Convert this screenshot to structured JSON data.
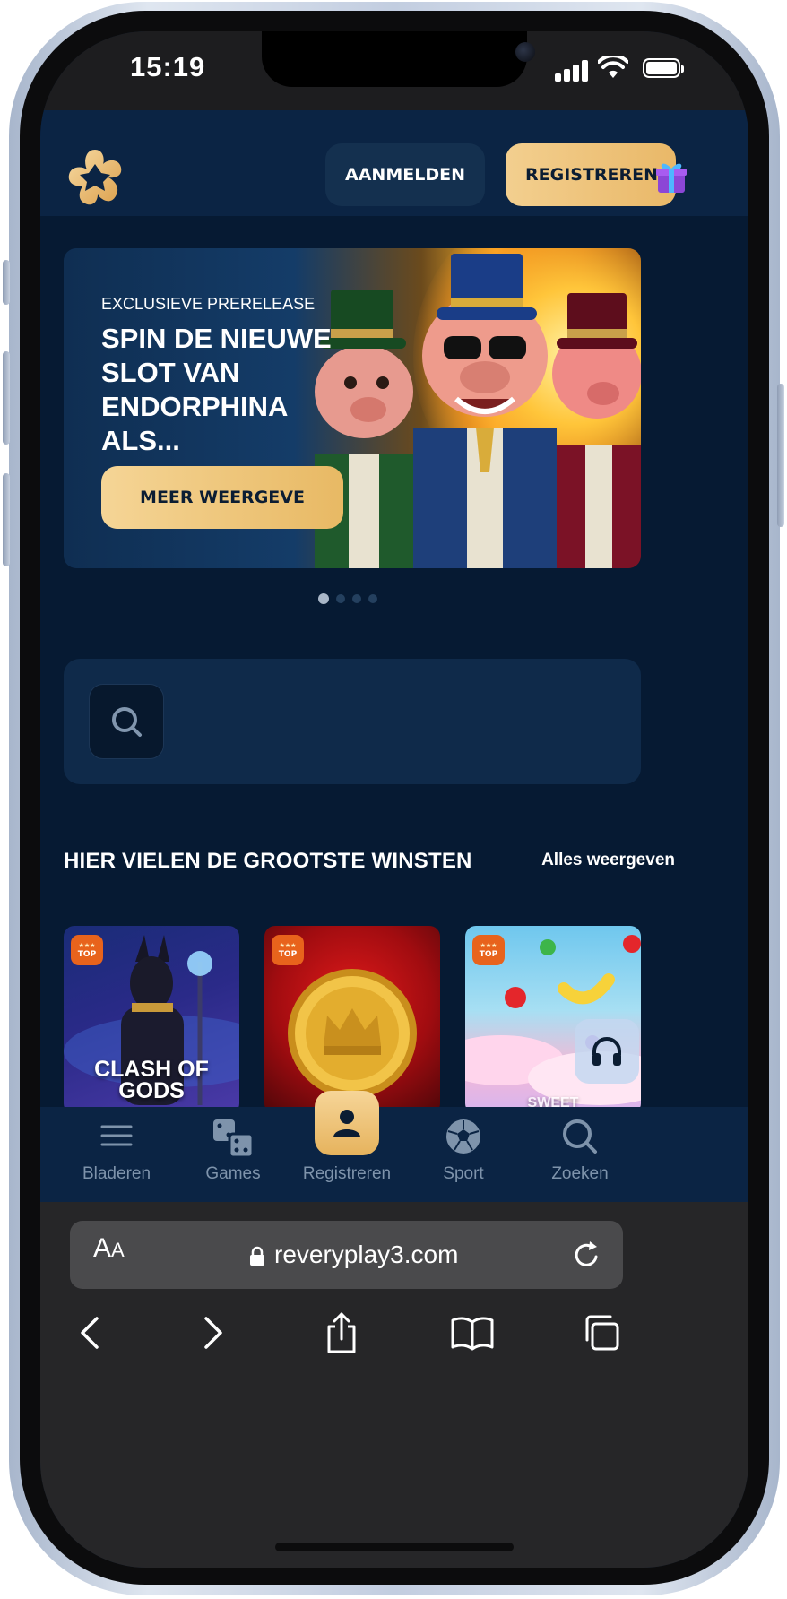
{
  "status_bar": {
    "time": "15:19"
  },
  "header": {
    "logo_icon": "brand-logo-icon",
    "login_label": "AANMELDEN",
    "register_label": "REGISTREREN",
    "gift_icon": "gift-icon",
    "accent_color": "#f0c67e"
  },
  "banner": {
    "eyebrow": "EXCLUSIEVE PRERELEASE",
    "title": "SPIN DE NIEUWE SLOT VAN ENDORPHINA ALS...",
    "button_label": "MEER WEERGEVE",
    "slide_count": 4,
    "active_slide": 1
  },
  "search": {
    "icon": "search-icon"
  },
  "section": {
    "title": "HIER VIELEN DE GROOTSTE WINSTEN",
    "link": "Alles weergeven"
  },
  "games": [
    {
      "caption": "CLASH OF GODS",
      "badge": "TOP",
      "badge_stars": "★★★"
    },
    {
      "caption": "",
      "badge": "TOP",
      "badge_stars": "★★★"
    },
    {
      "caption": "SWEET",
      "badge": "TOP",
      "badge_stars": "★★★"
    }
  ],
  "bottom_nav": [
    {
      "label": "Bladeren",
      "icon": "menu-icon"
    },
    {
      "label": "Games",
      "icon": "dice-icon"
    },
    {
      "label": "Registreren",
      "icon": "user-icon",
      "active": true
    },
    {
      "label": "Sport",
      "icon": "soccer-ball-icon"
    },
    {
      "label": "Zoeken",
      "icon": "search-icon"
    }
  ],
  "browser": {
    "aa_label": "A",
    "aa_small": "A",
    "url": "reveryplay3.com"
  }
}
